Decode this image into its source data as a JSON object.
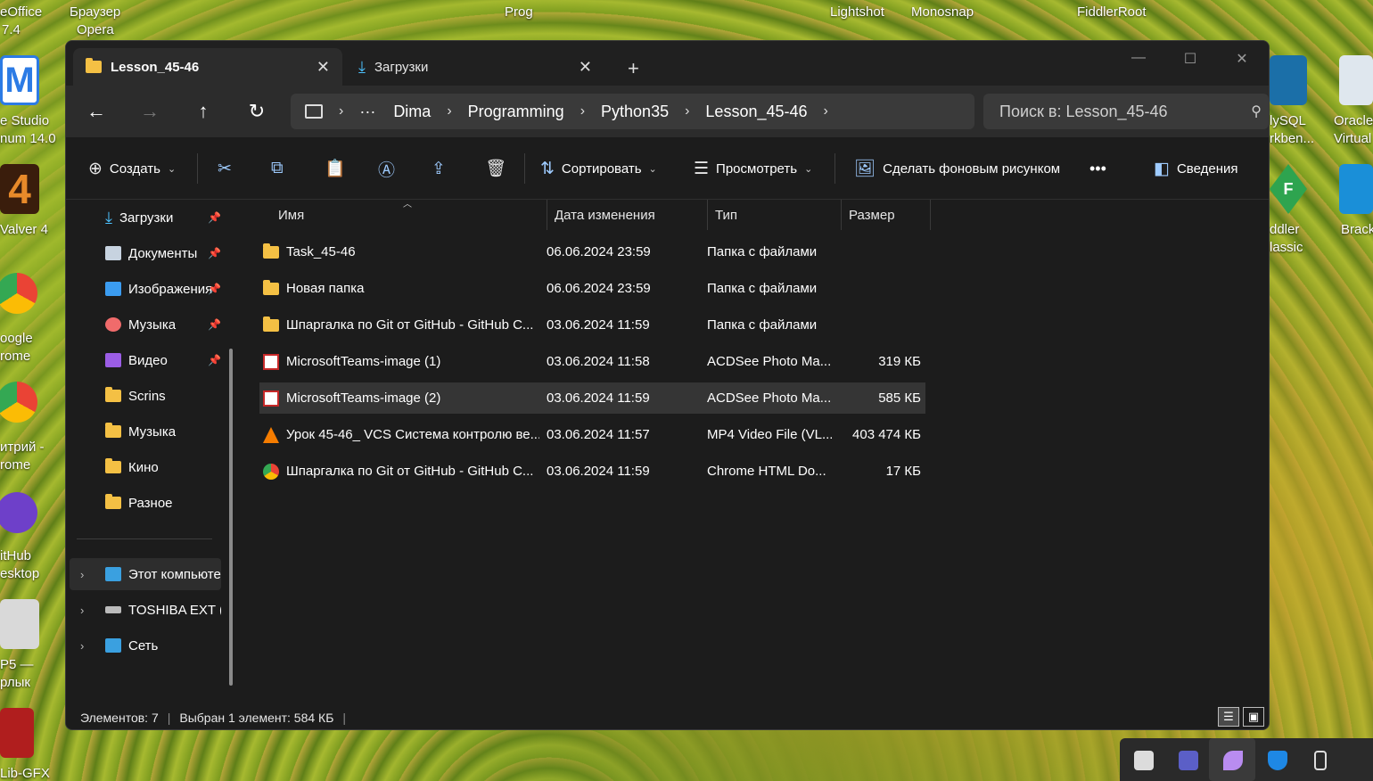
{
  "desktop": {
    "labels": [
      {
        "text": "eOffice"
      },
      {
        "text": "7.4"
      },
      {
        "text": "Браузер"
      },
      {
        "text": "Opera"
      },
      {
        "text": "Prog"
      },
      {
        "text": "Lightshot"
      },
      {
        "text": "Monosnap"
      },
      {
        "text": "FiddlerRoot"
      },
      {
        "text": "e Studio"
      },
      {
        "text": "num 14.0"
      },
      {
        "text": "Valver 4"
      },
      {
        "text": "oogle"
      },
      {
        "text": "rome"
      },
      {
        "text": "итрий -"
      },
      {
        "text": "rome"
      },
      {
        "text": "itHub"
      },
      {
        "text": "esktop"
      },
      {
        "text": "P5 —"
      },
      {
        "text": "рлык"
      },
      {
        "text": "Lib-GFX"
      },
      {
        "text": "lySQL"
      },
      {
        "text": "rkben..."
      },
      {
        "text": "Oracle"
      },
      {
        "text": "Virtual"
      },
      {
        "text": "ddler"
      },
      {
        "text": "lassic"
      },
      {
        "text": "Brack"
      }
    ]
  },
  "window": {
    "tabs": [
      {
        "label": "Lesson_45-46"
      },
      {
        "label": "Загрузки"
      }
    ],
    "new_tab": "+",
    "controls": {
      "minimize": "—",
      "maximize": "☐",
      "close": "✕"
    }
  },
  "nav": {
    "back": "←",
    "forward": "→",
    "up": "↑",
    "refresh": "↻",
    "breadcrumb": [
      "Dima",
      "Programming",
      "Python35",
      "Lesson_45-46"
    ],
    "more": "···",
    "search_placeholder": "Поиск в: Lesson_45-46"
  },
  "commands": {
    "create": "Создать",
    "sort": "Сортировать",
    "view": "Просмотреть",
    "set_wallpaper": "Сделать фоновым рисунком",
    "more": "•••",
    "details": "Сведения"
  },
  "sidebar": {
    "quick": [
      {
        "label": "Загрузки",
        "pinned": true,
        "color": "#4cc2ff"
      },
      {
        "label": "Документы",
        "pinned": true,
        "color": "#c7d3e0"
      },
      {
        "label": "Изображения",
        "pinned": true,
        "color": "#3b9cf0"
      },
      {
        "label": "Музыка",
        "pinned": true,
        "color": "#f06b6b"
      },
      {
        "label": "Видео",
        "pinned": true,
        "color": "#9b5de5"
      },
      {
        "label": "Scrins",
        "pinned": false,
        "color": "#f4c044"
      },
      {
        "label": "Музыка",
        "pinned": false,
        "color": "#f4c044"
      },
      {
        "label": "Кино",
        "pinned": false,
        "color": "#f4c044"
      },
      {
        "label": "Разное",
        "pinned": false,
        "color": "#f4c044"
      }
    ],
    "locations": [
      {
        "label": "Этот компьютер",
        "color": "#3aa0e0"
      },
      {
        "label": "TOSHIBA EXT (D:",
        "color": "#bbbbbb"
      },
      {
        "label": "Сеть",
        "color": "#3aa0e0"
      }
    ]
  },
  "columns": {
    "name": "Имя",
    "date": "Дата изменения",
    "type": "Тип",
    "size": "Размер"
  },
  "files": [
    {
      "name": "Task_45-46",
      "date": "06.06.2024 23:59",
      "type": "Папка с файлами",
      "size": "",
      "icon": "folder-icon",
      "selected": false
    },
    {
      "name": "Новая папка",
      "date": "06.06.2024 23:59",
      "type": "Папка с файлами",
      "size": "",
      "icon": "folder-icon",
      "selected": false
    },
    {
      "name": "Шпаргалка по Git от GitHub - GitHub C...",
      "date": "03.06.2024 11:59",
      "type": "Папка с файлами",
      "size": "",
      "icon": "folder-icon",
      "selected": false
    },
    {
      "name": "MicrosoftTeams-image (1)",
      "date": "03.06.2024 11:58",
      "type": "ACDSee Photo Ma...",
      "size": "319 КБ",
      "icon": "image-file-icon",
      "selected": false
    },
    {
      "name": "MicrosoftTeams-image (2)",
      "date": "03.06.2024 11:59",
      "type": "ACDSee Photo Ma...",
      "size": "585 КБ",
      "icon": "image-file-icon",
      "selected": true
    },
    {
      "name": "Урок 45-46_ VCS Система контролю ве...",
      "date": "03.06.2024 11:57",
      "type": "MP4 Video File (VL...",
      "size": "403 474 КБ",
      "icon": "vlc-icon",
      "selected": false
    },
    {
      "name": "Шпаргалка по Git от GitHub - GitHub C...",
      "date": "03.06.2024 11:59",
      "type": "Chrome HTML Do...",
      "size": "17 КБ",
      "icon": "chrome-icon",
      "selected": false
    }
  ],
  "status": {
    "items": "Элементов: 7",
    "selected": "Выбран 1 элемент: 584 КБ"
  }
}
